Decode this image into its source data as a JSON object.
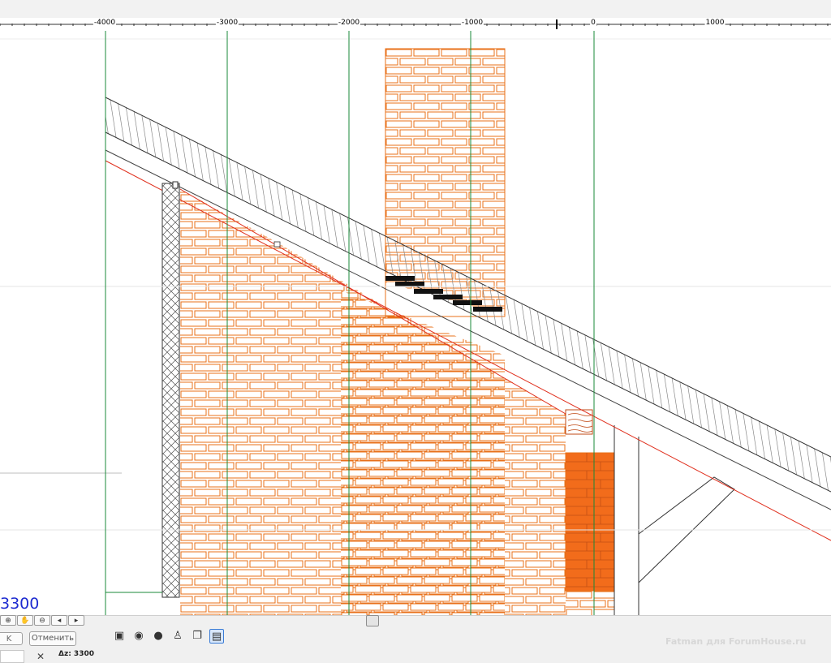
{
  "ruler": {
    "labels": [
      "-4000",
      "-3000",
      "-2000",
      "-1000",
      "0",
      "1000"
    ]
  },
  "canvas": {
    "coordinate_readout": "3300",
    "colors": {
      "background": "#ffffff",
      "gridline": "#1a8a3a",
      "brick_fill": "#ffffff",
      "brick_outline": "#e8701a",
      "brick_solid": "#f26c1b",
      "roof_line": "#8a8a8a",
      "roof_underside": "#e0301e",
      "sheathing": "#555555",
      "step_blocks": "#111111"
    }
  },
  "statusbar": {
    "partial_button_label": "K",
    "cancel_button_label": "Отменить",
    "dz_label": "Δz: 3300"
  },
  "view_tools": {
    "icons": [
      "3d-box-icon",
      "camera-icon",
      "sphere-icon",
      "walk-icon",
      "copy-icon",
      "paste-icon"
    ],
    "active": "paste-icon"
  },
  "watermark": "Fatman для ForumHouse.ru"
}
